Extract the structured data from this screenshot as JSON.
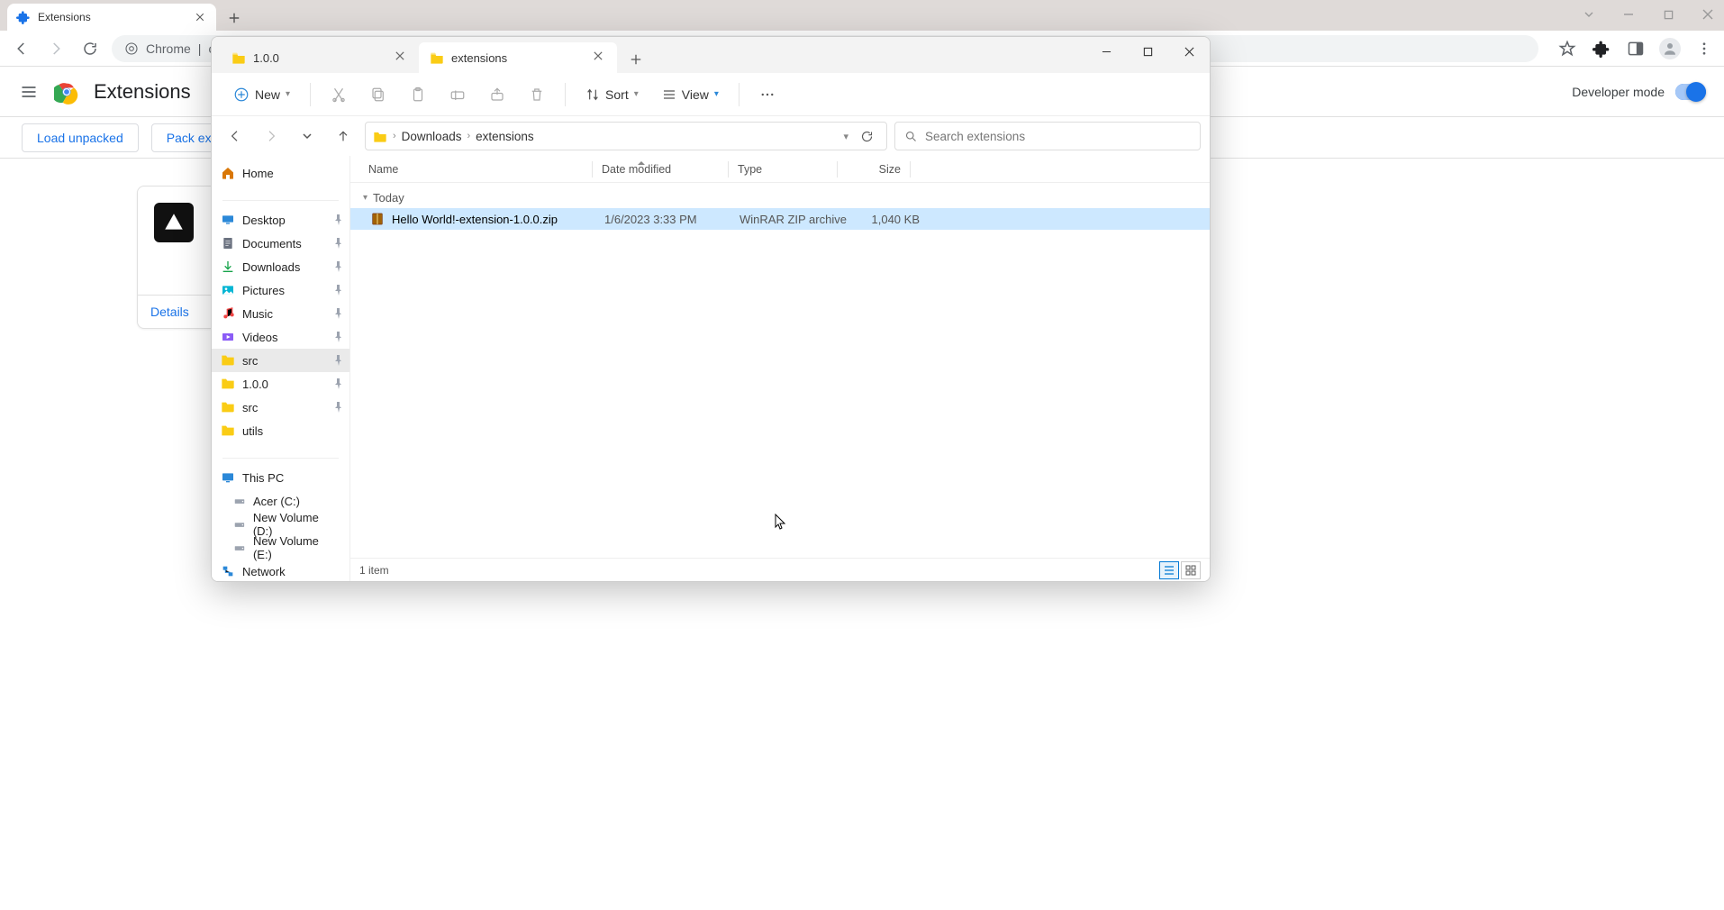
{
  "browser": {
    "tab_title": "Extensions",
    "omnibox_prefix": "Chrome",
    "omnibox_text": "chro",
    "ext_page": {
      "title": "Extensions",
      "dev_mode_label": "Developer mode",
      "buttons": {
        "load_unpacked": "Load unpacked",
        "pack_extension": "Pack exte"
      },
      "card": {
        "details": "Details"
      }
    }
  },
  "explorer": {
    "tabs": [
      {
        "label": "1.0.0",
        "active": false
      },
      {
        "label": "extensions",
        "active": true
      }
    ],
    "toolbar": {
      "new": "New",
      "sort": "Sort",
      "view": "View"
    },
    "breadcrumbs": [
      "Downloads",
      "extensions"
    ],
    "search_placeholder": "Search extensions",
    "columns": {
      "name": "Name",
      "date": "Date modified",
      "type": "Type",
      "size": "Size"
    },
    "group_label": "Today",
    "files": [
      {
        "name": "Hello World!-extension-1.0.0.zip",
        "date": "1/6/2023 3:33 PM",
        "type": "WinRAR ZIP archive",
        "size": "1,040 KB"
      }
    ],
    "nav": {
      "home": "Home",
      "quick": [
        {
          "label": "Desktop",
          "pinned": true,
          "icon": "desktop"
        },
        {
          "label": "Documents",
          "pinned": true,
          "icon": "doc"
        },
        {
          "label": "Downloads",
          "pinned": true,
          "icon": "download"
        },
        {
          "label": "Pictures",
          "pinned": true,
          "icon": "pic"
        },
        {
          "label": "Music",
          "pinned": true,
          "icon": "music"
        },
        {
          "label": "Videos",
          "pinned": true,
          "icon": "video"
        },
        {
          "label": "src",
          "pinned": true,
          "icon": "folder",
          "selected": true
        },
        {
          "label": "1.0.0",
          "pinned": true,
          "icon": "folder"
        },
        {
          "label": "src",
          "pinned": true,
          "icon": "folder"
        },
        {
          "label": "utils",
          "pinned": false,
          "icon": "folder"
        }
      ],
      "thispc": "This PC",
      "drives": [
        {
          "label": "Acer (C:)"
        },
        {
          "label": "New Volume (D:)"
        },
        {
          "label": "New Volume (E:)"
        }
      ],
      "network": "Network"
    },
    "status": "1 item"
  }
}
